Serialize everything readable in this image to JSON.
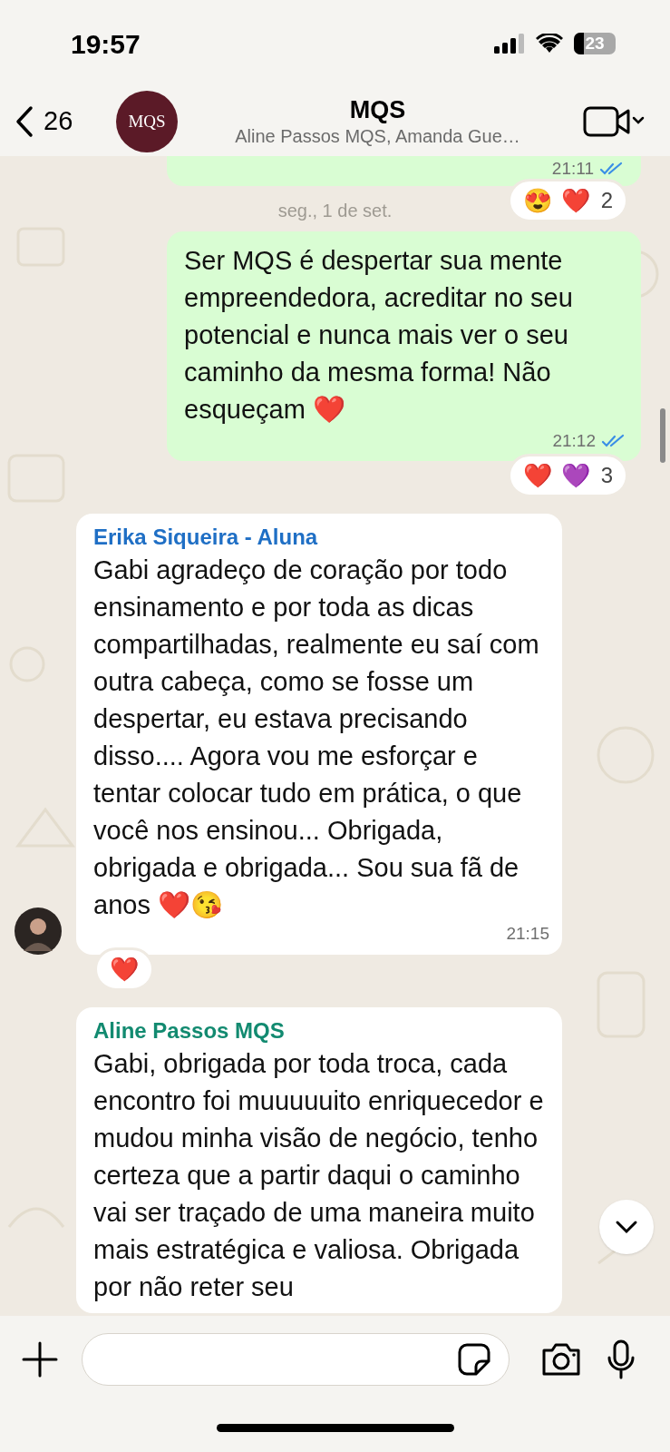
{
  "status_bar": {
    "time": "19:57",
    "battery": "23"
  },
  "header": {
    "back_count": "26",
    "avatar_text": "MQS",
    "title": "MQS",
    "subtitle": "Aline Passos MQS, Amanda Gue…"
  },
  "messages": [
    {
      "kind": "outgoing",
      "partial": true,
      "time": "21:11",
      "read": true,
      "reactions": [
        "😍",
        "❤️"
      ],
      "reaction_count": "2"
    },
    {
      "kind": "date",
      "text": "seg., 1 de set."
    },
    {
      "kind": "outgoing",
      "partial": false,
      "text": "Ser MQS é despertar sua mente empreendedora, acreditar no seu potencial e nunca mais ver o seu caminho da mesma forma! Não esqueçam ❤️",
      "time": "21:12",
      "read": true,
      "reactions": [
        "❤️",
        "💜"
      ],
      "reaction_count": "3"
    },
    {
      "kind": "incoming",
      "sender": "Erika Siqueira - Aluna",
      "color": "#1f6fc5",
      "avatar": true,
      "text": "Gabi agradeço de coração por todo ensinamento e por toda as dicas compartilhadas, realmente eu saí com outra cabeça, como se fosse um despertar, eu estava precisando disso.... Agora vou me esforçar e tentar colocar tudo em prática, o que você nos ensinou... Obrigada, obrigada e obrigada... Sou sua fã de anos ❤️😘",
      "time": "21:15",
      "reactions": [
        "❤️"
      ]
    },
    {
      "kind": "incoming",
      "sender": "Aline Passos MQS",
      "color": "#128a70",
      "avatar": false,
      "text": "Gabi, obrigada por toda troca, cada encontro foi muuuuuito enriquecedor e mudou minha visão de negócio, tenho certeza que a partir daqui o caminho vai ser traçado de uma maneira muito mais estratégica e valiosa. Obrigada por não reter seu"
    }
  ]
}
